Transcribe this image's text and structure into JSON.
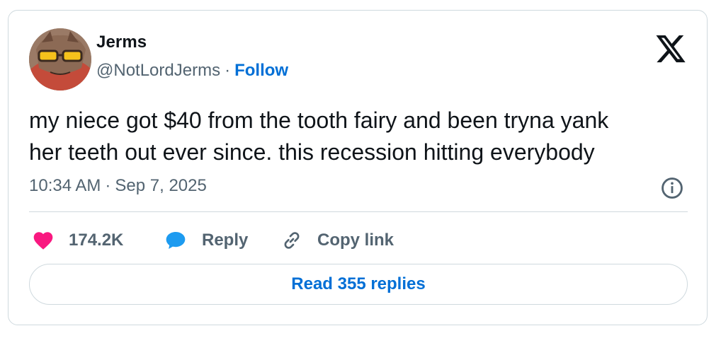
{
  "author": {
    "name": "Jerms",
    "handle": "@NotLordJerms",
    "separator": "·",
    "follow_label": "Follow"
  },
  "icons": {
    "platform": "x-logo-icon",
    "info": "info-icon",
    "like": "heart-icon",
    "reply": "speech-bubble-icon",
    "copy_link": "link-icon"
  },
  "tweet": {
    "text": "my niece got $40 from the tooth fairy and been tryna yank\nher teeth out ever since. this recession hitting everybody",
    "time": "10:34 AM",
    "separator": "·",
    "date": "Sep 7, 2025"
  },
  "actions": {
    "like_count": "174.2K",
    "reply_label": "Reply",
    "copy_link_label": "Copy link"
  },
  "footer": {
    "read_replies_label": "Read 355 replies"
  },
  "colors": {
    "accent": "#006fd6",
    "like": "#f91880",
    "reply": "#1d9bf0",
    "muted": "#536471",
    "border": "#cfd9de"
  }
}
